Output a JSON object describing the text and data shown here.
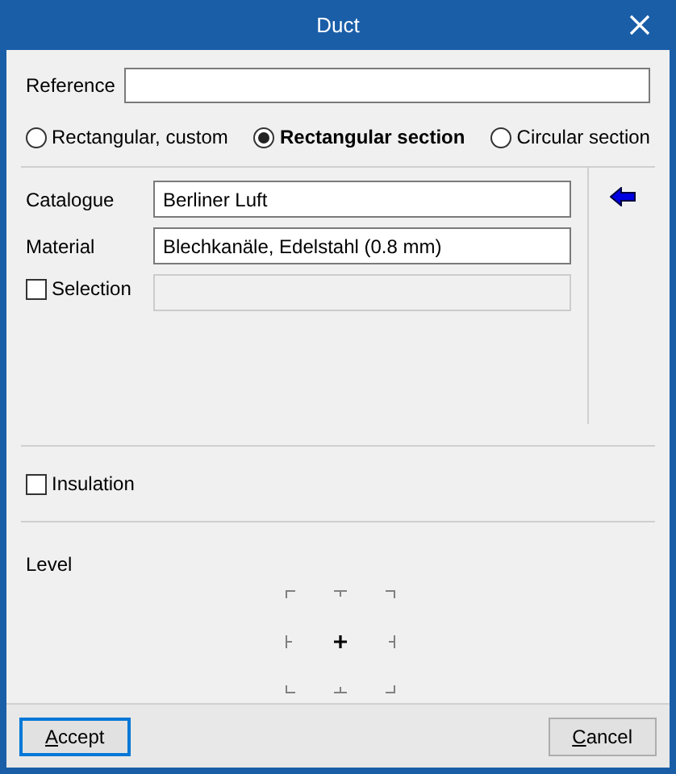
{
  "window": {
    "title": "Duct"
  },
  "reference": {
    "label": "Reference"
  },
  "section_types": [
    {
      "label": "Rectangular, custom",
      "selected": false
    },
    {
      "label": "Rectangular section",
      "selected": true
    },
    {
      "label": "Circular section",
      "selected": false
    }
  ],
  "catalogue": {
    "label": "Catalogue",
    "value": "Berliner Luft"
  },
  "material": {
    "label": "Material",
    "value": "Blechkanäle, Edelstahl (0.8 mm)"
  },
  "selection": {
    "label": "Selection",
    "checked": false,
    "disabled": true
  },
  "insulation": {
    "label": "Insulation",
    "checked": false
  },
  "level_anchor": {
    "label": "Level",
    "points": [
      {
        "selected": false
      },
      {
        "selected": false
      },
      {
        "selected": false
      },
      {
        "selected": false
      },
      {
        "selected": true
      },
      {
        "selected": false
      },
      {
        "selected": false
      },
      {
        "selected": false
      },
      {
        "selected": false
      }
    ]
  },
  "buttons": [
    {
      "label": "Accept",
      "default": true
    },
    {
      "label": "Cancel",
      "default": false
    }
  ]
}
